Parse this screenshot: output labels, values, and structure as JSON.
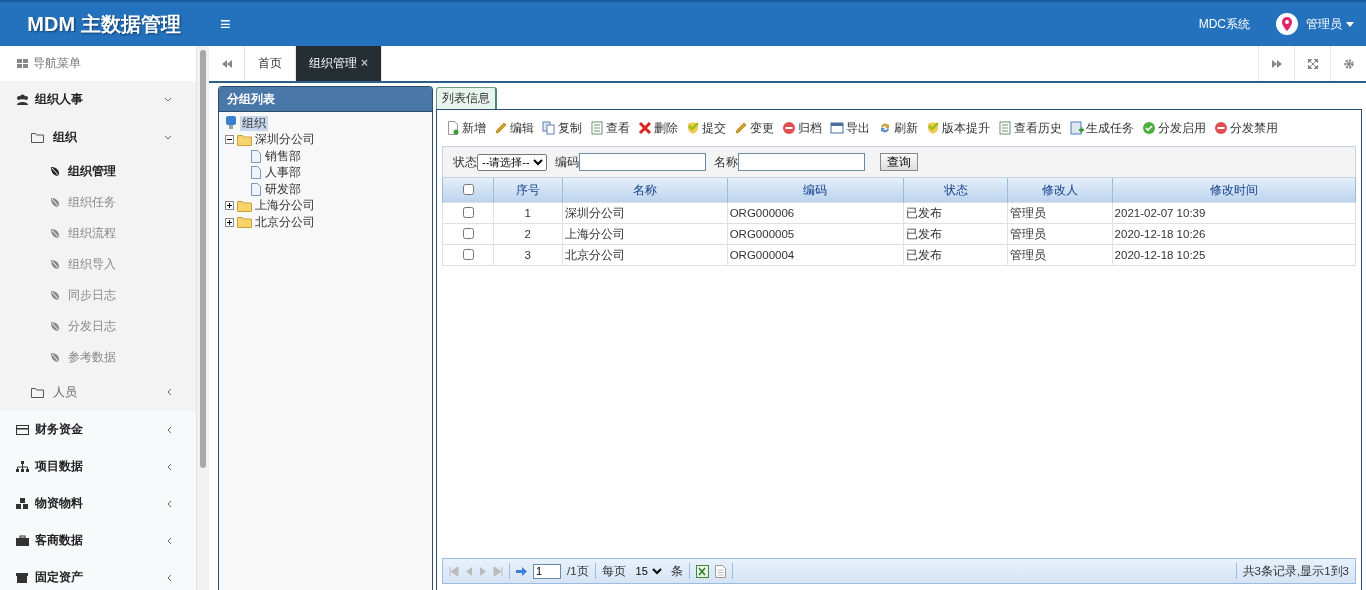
{
  "header": {
    "logo": "MDM 主数据管理",
    "menu_glyph": "≡",
    "system_link": "MDC系统",
    "user": "管理员"
  },
  "sidebar": {
    "title": "导航菜单",
    "items": [
      {
        "label": "组织人事",
        "expanded": true,
        "children": [
          {
            "label": "组织",
            "expanded": true,
            "children": [
              {
                "label": "组织管理",
                "selected": true
              },
              {
                "label": "组织任务",
                "selected": false
              },
              {
                "label": "组织流程",
                "selected": false
              },
              {
                "label": "组织导入",
                "selected": false
              },
              {
                "label": "同步日志",
                "selected": false
              },
              {
                "label": "分发日志",
                "selected": false
              },
              {
                "label": "参考数据",
                "selected": false
              }
            ]
          },
          {
            "label": "人员",
            "expanded": false
          }
        ]
      },
      {
        "label": "财务资金",
        "expanded": false
      },
      {
        "label": "项目数据",
        "expanded": false
      },
      {
        "label": "物资物料",
        "expanded": false
      },
      {
        "label": "客商数据",
        "expanded": false
      },
      {
        "label": "固定资产",
        "expanded": false
      }
    ]
  },
  "tabs": [
    {
      "label": "首页",
      "selected": false,
      "closable": false
    },
    {
      "label": "组织管理",
      "selected": true,
      "closable": true
    }
  ],
  "tab_close_glyph": "×",
  "group_panel": {
    "title": "分组列表",
    "tree": {
      "label": "组织",
      "children": [
        {
          "label": "深圳分公司",
          "expanded": true,
          "children": [
            {
              "label": "销售部"
            },
            {
              "label": "人事部"
            },
            {
              "label": "研发部"
            }
          ]
        },
        {
          "label": "上海分公司",
          "expanded": false
        },
        {
          "label": "北京分公司",
          "expanded": false
        }
      ]
    }
  },
  "list_panel": {
    "tab": "列表信息",
    "toolbar": [
      {
        "kind": "new",
        "label": "新增"
      },
      {
        "kind": "edit",
        "label": "编辑"
      },
      {
        "kind": "copy",
        "label": "复制"
      },
      {
        "kind": "view",
        "label": "查看"
      },
      {
        "kind": "delete",
        "label": "删除"
      },
      {
        "kind": "submit",
        "label": "提交"
      },
      {
        "kind": "edit",
        "label": "变更"
      },
      {
        "kind": "stop",
        "label": "归档"
      },
      {
        "kind": "export",
        "label": "导出"
      },
      {
        "kind": "refresh",
        "label": "刷新"
      },
      {
        "kind": "submit",
        "label": "版本提升"
      },
      {
        "kind": "view",
        "label": "查看历史"
      },
      {
        "kind": "task",
        "label": "生成任务"
      },
      {
        "kind": "ok",
        "label": "分发启用"
      },
      {
        "kind": "stop",
        "label": "分发禁用"
      }
    ],
    "filters": {
      "status_label": "状态",
      "status_value": "--请选择--",
      "code_label": "编码",
      "name_label": "名称",
      "search_button": "查询"
    },
    "table": {
      "header_checked": false,
      "columns": [
        "序号",
        "名称",
        "编码",
        "状态",
        "修改人",
        "修改时间"
      ],
      "rows": [
        {
          "checked": false,
          "cells": [
            "1",
            "深圳分公司",
            "ORG000006",
            "已发布",
            "管理员",
            "2021-02-07 10:39"
          ]
        },
        {
          "checked": false,
          "cells": [
            "2",
            "上海分公司",
            "ORG000005",
            "已发布",
            "管理员",
            "2020-12-18 10:26"
          ]
        },
        {
          "checked": false,
          "cells": [
            "3",
            "北京分公司",
            "ORG000004",
            "已发布",
            "管理员",
            "2020-12-18 10:25"
          ]
        }
      ]
    },
    "pager": {
      "page": "1",
      "page_total": "/1页",
      "per_page_label": "每页",
      "per_page": "15",
      "per_page_unit": "条",
      "summary": "共3条记录,显示1到3"
    }
  }
}
